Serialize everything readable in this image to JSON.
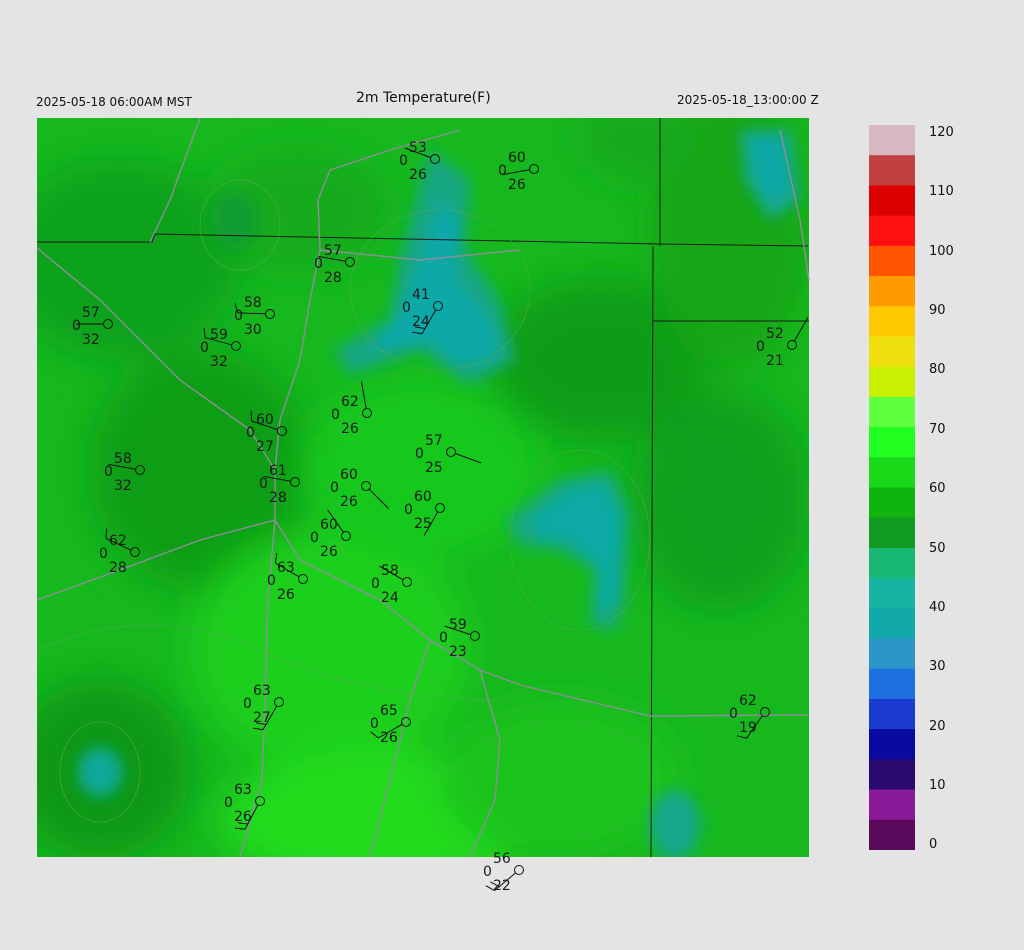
{
  "header": {
    "local_time": "2025-05-18 06:00AM MST",
    "title": "2m Temperature(F)",
    "valid_time": "2025-05-18_13:00:00 Z"
  },
  "colorbar": {
    "labels": [
      "120",
      "110",
      "100",
      "90",
      "80",
      "70",
      "60",
      "50",
      "40",
      "30",
      "20",
      "10",
      "0"
    ],
    "stops": [
      {
        "v": 0,
        "c": "#200020"
      },
      {
        "v": 5,
        "c": "#5a0a5a"
      },
      {
        "v": 10,
        "c": "#8a1a9a"
      },
      {
        "v": 15,
        "c": "#2a0a70"
      },
      {
        "v": 20,
        "c": "#0a0aa0"
      },
      {
        "v": 25,
        "c": "#1a3ad0"
      },
      {
        "v": 30,
        "c": "#1e70e0"
      },
      {
        "v": 35,
        "c": "#2a96c8"
      },
      {
        "v": 40,
        "c": "#10a8a8"
      },
      {
        "v": 45,
        "c": "#14b4a0"
      },
      {
        "v": 50,
        "c": "#18b874"
      },
      {
        "v": 55,
        "c": "#109a22"
      },
      {
        "v": 60,
        "c": "#10b410"
      },
      {
        "v": 65,
        "c": "#18d818"
      },
      {
        "v": 70,
        "c": "#20ff20"
      },
      {
        "v": 75,
        "c": "#60ff40"
      },
      {
        "v": 80,
        "c": "#c8f000"
      },
      {
        "v": 85,
        "c": "#f0e010"
      },
      {
        "v": 90,
        "c": "#ffc800"
      },
      {
        "v": 95,
        "c": "#ff9a00"
      },
      {
        "v": 100,
        "c": "#ff5500"
      },
      {
        "v": 105,
        "c": "#ff1010"
      },
      {
        "v": 110,
        "c": "#dd0000"
      },
      {
        "v": 115,
        "c": "#c04040"
      },
      {
        "v": 120,
        "c": "#d8b8c0"
      }
    ]
  },
  "stations": [
    {
      "t": "53",
      "d": "26",
      "c": "0"
    },
    {
      "t": "60",
      "d": "26",
      "c": "0"
    },
    {
      "t": "57",
      "d": "28",
      "c": "0"
    },
    {
      "t": "41",
      "d": "24",
      "c": "0"
    },
    {
      "t": "57",
      "d": "32",
      "c": "0"
    },
    {
      "t": "58",
      "d": "30",
      "c": "0"
    },
    {
      "t": "59",
      "d": "32",
      "c": "0"
    },
    {
      "t": "52",
      "d": "21",
      "c": "0"
    },
    {
      "t": "62",
      "d": "26",
      "c": "0"
    },
    {
      "t": "60",
      "d": "27",
      "c": "0"
    },
    {
      "t": "57",
      "d": "25",
      "c": "0"
    },
    {
      "t": "58",
      "d": "32",
      "c": "0"
    },
    {
      "t": "61",
      "d": "28",
      "c": "0"
    },
    {
      "t": "60",
      "d": "26",
      "c": "0"
    },
    {
      "t": "60",
      "d": "25",
      "c": "0"
    },
    {
      "t": "60",
      "d": "26",
      "c": "0"
    },
    {
      "t": "62",
      "d": "28",
      "c": "0"
    },
    {
      "t": "63",
      "d": "26",
      "c": "0"
    },
    {
      "t": "58",
      "d": "24",
      "c": "0"
    },
    {
      "t": "59",
      "d": "23",
      "c": "0"
    },
    {
      "t": "63",
      "d": "27",
      "c": "0"
    },
    {
      "t": "65",
      "d": "26",
      "c": "0"
    },
    {
      "t": "62",
      "d": "19",
      "c": "0"
    },
    {
      "t": "63",
      "d": "26",
      "c": "0"
    },
    {
      "t": "56",
      "d": "22",
      "c": "0"
    }
  ]
}
